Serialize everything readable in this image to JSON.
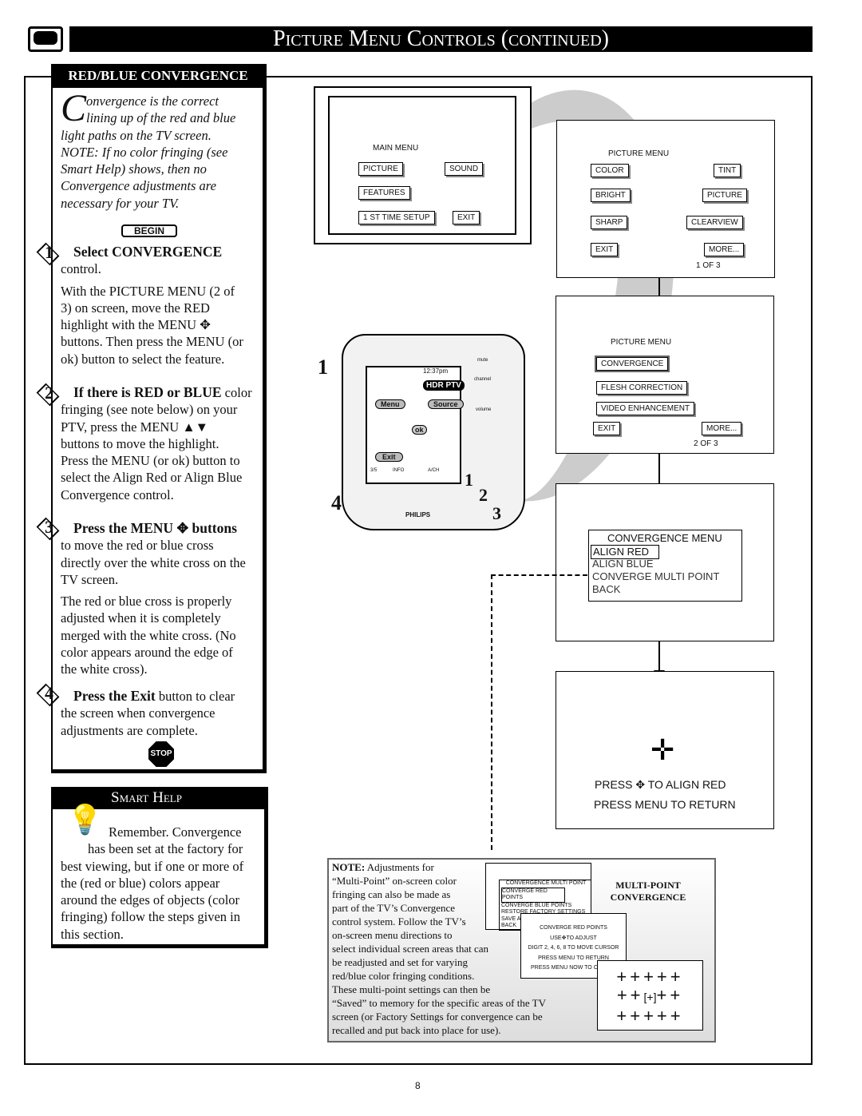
{
  "header": {
    "title": "Picture Menu Controls (continued)",
    "tv_icon": "tv-icon"
  },
  "left": {
    "heading": "RED/BLUE CONVERGENCE",
    "intro_initial": "C",
    "intro_lines": [
      "onvergence is the correct",
      "lining up of the red and blue",
      "light paths on the TV screen.",
      "NOTE: If no color fringing (see",
      "Smart Help) shows, then no",
      "Convergence adjustments are",
      "necessary for your TV."
    ],
    "begin": "BEGIN",
    "steps": [
      {
        "num": "1",
        "title": "Select CONVERGENCE",
        "rest": "control.",
        "body": [
          "With the PICTURE MENU (2 of",
          "3) on screen, move the RED",
          "highlight with the MENU",
          "buttons. Then press the MENU (or",
          "ok) button to select the feature."
        ]
      },
      {
        "num": "2",
        "title": "If there is RED or BLUE",
        "title_rest": " color",
        "body": [
          "fringing (see note below) on your",
          "PTV, press the MENU ▲▼",
          "buttons to move the highlight.",
          "Press the MENU (or ok) button to",
          "select the Align Red or Align Blue",
          "Convergence control."
        ]
      },
      {
        "num": "3",
        "title": "Press the MENU",
        "title_rest": "buttons",
        "body": [
          "to move the red or blue cross",
          "directly over the white cross on the",
          "TV screen."
        ],
        "body2": [
          "The red or blue cross is properly",
          "adjusted when it is completely",
          "merged with the white cross. (No",
          "color appears around the edge of",
          "the white cross)."
        ]
      },
      {
        "num": "4",
        "title": "Press the Exit",
        "title_rest": " button to clear",
        "body": [
          "the screen when convergence",
          "adjustments are complete."
        ]
      }
    ],
    "stop": "STOP"
  },
  "smart_help": {
    "title": "Smart Help",
    "lines": [
      "Remember. Convergence",
      "has been set at the factory for",
      "best viewing, but if one or more of",
      "the (red or blue) colors appear",
      "around the edges of objects (color",
      "fringing) follow the steps given in",
      "this section."
    ]
  },
  "main_menu": {
    "title": "MAIN MENU",
    "items": [
      "PICTURE",
      "SOUND",
      "FEATURES",
      "1 ST TIME SETUP",
      "EXIT"
    ]
  },
  "picture_menu_1": {
    "title": "PICTURE MENU",
    "items": [
      "COLOR",
      "TINT",
      "BRIGHT",
      "PICTURE",
      "SHARP",
      "CLEARVIEW",
      "EXIT",
      "MORE..."
    ],
    "page": "1 OF 3"
  },
  "picture_menu_2": {
    "title": "PICTURE MENU",
    "items": [
      "CONVERGENCE",
      "FLESH CORRECTION",
      "VIDEO ENHANCEMENT",
      "EXIT",
      "MORE..."
    ],
    "page": "2 OF 3"
  },
  "remote": {
    "time": "12:37pm",
    "device": "HDR PTV",
    "menu": "Menu",
    "source": "Source",
    "ok": "ok",
    "exit": "Exit",
    "page": "3/5",
    "info": "INFO",
    "aor": "A/CH",
    "mute": "mute",
    "channel": "channel",
    "volume": "volume",
    "brand": "PHILIPS",
    "callouts": [
      "1",
      "4",
      "1",
      "2",
      "3"
    ]
  },
  "convergence_menu": {
    "title": "CONVERGENCE MENU",
    "items": [
      "ALIGN RED",
      "ALIGN BLUE",
      "CONVERGE MULTI POINT",
      "BACK"
    ]
  },
  "align_screen": {
    "line1a": "PRESS",
    "line1b": "TO ALIGN RED",
    "line2": "PRESS MENU TO RETURN"
  },
  "note": {
    "label": "NOTE:",
    "lines": [
      " Adjustments for",
      "“Multi-Point” on-screen color",
      "fringing can also be made as",
      "part of the TV’s Convergence",
      "control system. Follow the TV’s",
      "on-screen menu directions to",
      "select individual screen areas that can",
      "be readjusted and set for varying",
      "red/blue color fringing conditions.",
      "These multi-point settings can then be",
      "“Saved” to memory for the specific areas of the TV",
      "screen (or Factory Settings for convergence can be",
      "recalled and put back into place for use)."
    ],
    "heading": [
      "MULTI-POINT",
      "CONVERGENCE"
    ],
    "mp_menu": [
      "CONVERGENCE MULTI POINT",
      "CONVERGE RED POINTS",
      "CONVERGE BLUE POINTS",
      "RESTORE FACTORY SETTINGS",
      "SAVE ADJUSTMENTS",
      "BACK"
    ],
    "red_points": [
      "CONVERGE RED POINTS",
      "USE",
      "TO ADJUST",
      "DIGIT 2, 4, 6, 8 TO MOVE CURSOR",
      "PRESS MENU TO RETURN",
      "PRESS MENU NOW TO CON"
    ]
  },
  "page_number": "8"
}
